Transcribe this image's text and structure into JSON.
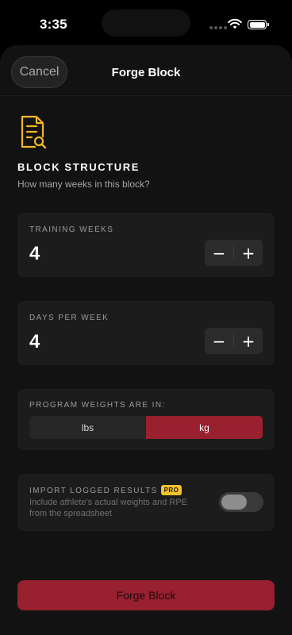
{
  "status_bar": {
    "time": "3:35"
  },
  "nav": {
    "cancel_label": "Cancel",
    "title": "Forge Block"
  },
  "header": {
    "icon": "document-search-icon",
    "title": "BLOCK STRUCTURE",
    "subtitle": "How many weeks in this block?"
  },
  "training_weeks": {
    "label": "TRAINING WEEKS",
    "value": "4",
    "minus": "−",
    "plus": "+"
  },
  "days_per_week": {
    "label": "DAYS PER WEEK",
    "value": "4",
    "minus": "−",
    "plus": "+"
  },
  "units": {
    "label": "PROGRAM WEIGHTS ARE IN:",
    "options": [
      "lbs",
      "kg"
    ],
    "selected": "kg"
  },
  "import_results": {
    "label": "IMPORT LOGGED RESULTS",
    "badge": "PRO",
    "description": "Include athlete's actual weights and RPE from the spreadsheet",
    "enabled": false
  },
  "footer": {
    "forge_label": "Forge Block"
  },
  "colors": {
    "accent": "#98202f",
    "icon_gold": "#f4b728",
    "badge_gold": "#f4c22b",
    "card_bg": "#1c1c1c",
    "sheet_bg": "#121212"
  }
}
